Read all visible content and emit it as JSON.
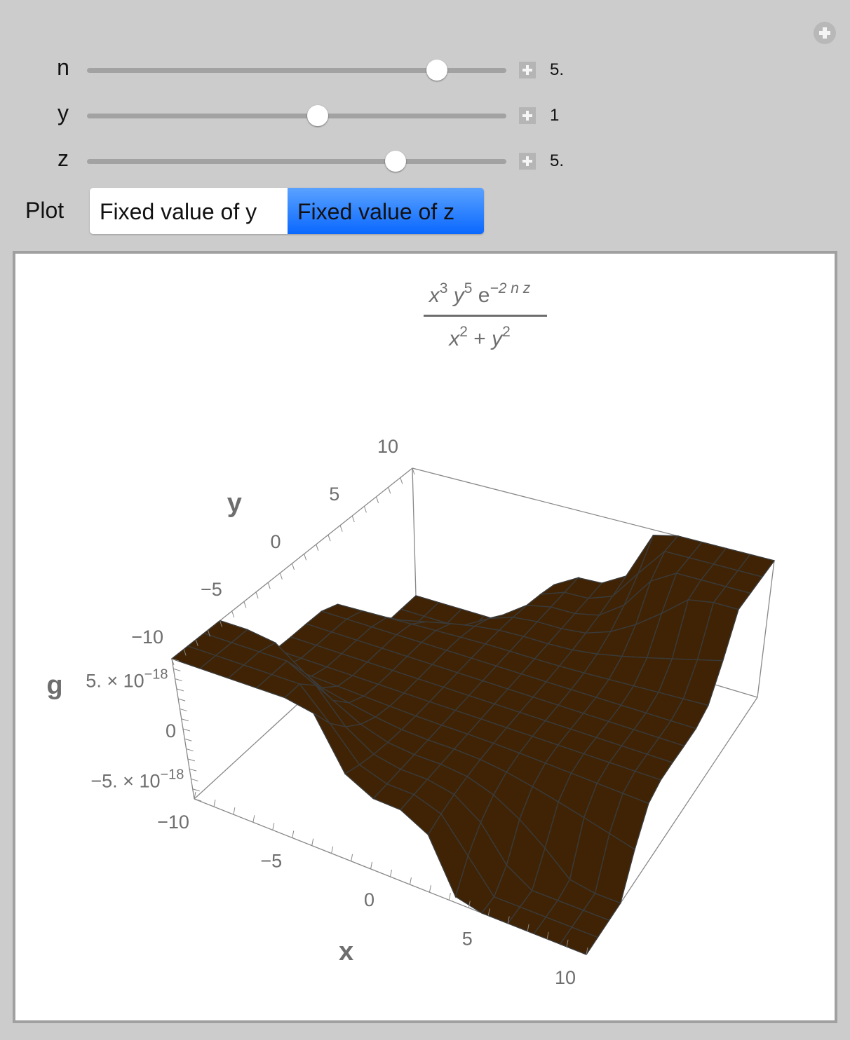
{
  "controls": {
    "sliders": [
      {
        "name": "n",
        "value_text": "5.",
        "fraction": 0.835
      },
      {
        "name": "y",
        "value_text": "1",
        "fraction": 0.55
      },
      {
        "name": "z",
        "value_text": "5.",
        "fraction": 0.735
      }
    ],
    "plot_selector": {
      "label": "Plot",
      "options": [
        "Fixed value of y",
        "Fixed value of z"
      ],
      "selected": "Fixed value of z"
    }
  },
  "icons": {
    "corner": "add-circle-icon",
    "slider_expand": "plus-icon"
  },
  "colors": {
    "panel_bg": "#cccccc",
    "selected_button": "#0a68ff",
    "surface": "#3f2304",
    "mesh": "#3a3a3a",
    "axis_text": "#6e6e6e"
  },
  "formula": {
    "numerator": [
      "x",
      "3",
      "y",
      "5",
      "e",
      "−2 n z"
    ],
    "denominator": [
      "x",
      "2",
      "+",
      "y",
      "2"
    ]
  },
  "chart_data": {
    "type": "surface3d",
    "title": "x^3 y^5 e^(−2 n z) / (x^2 + y^2)",
    "function": "g(x,y) = x^3 y^5 exp(-2 n z)/(x^2+y^2), n=5, z=5",
    "axes": {
      "x": {
        "label": "x",
        "range": [
          -10,
          10
        ],
        "ticks": [
          "−10",
          "−5",
          "0",
          "5",
          "10"
        ]
      },
      "y": {
        "label": "y",
        "range": [
          -10,
          10
        ],
        "ticks": [
          "−10",
          "−5",
          "0",
          "5",
          "10"
        ]
      },
      "g": {
        "label": "g",
        "range": [
          -7e-18,
          7e-18
        ],
        "ticks": [
          {
            "mantissa": "5.",
            "exponent": "−18"
          },
          {
            "mantissa": "0",
            "exponent": ""
          },
          {
            "mantissa": "−5.",
            "exponent": "−18"
          }
        ]
      }
    },
    "mesh": "15x15 grid",
    "grid": false,
    "legend": "none"
  }
}
